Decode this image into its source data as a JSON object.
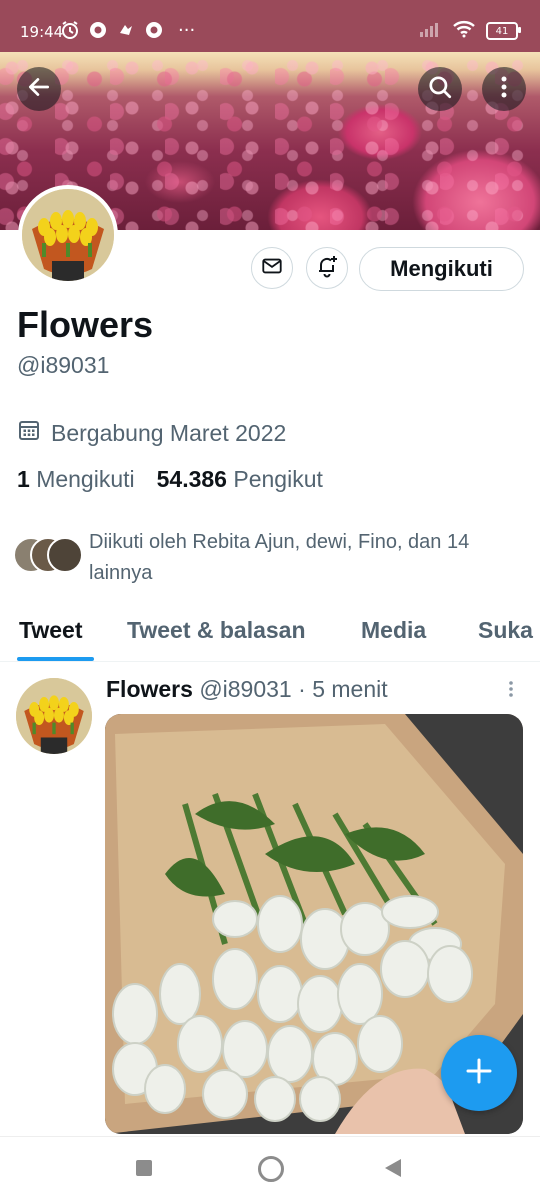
{
  "status_bar": {
    "time": "19:44",
    "battery": "41",
    "more": "···"
  },
  "profile": {
    "name": "Flowers",
    "handle": "@i89031",
    "joined": "Bergabung Maret 2022",
    "following_count": "1",
    "following_label": "Mengikuti",
    "followers_count": "54.386",
    "followers_label": "Pengikut",
    "followed_by": "Diikuti oleh Rebita Ajun, dewi, Fino, dan 14 lainnya",
    "follow_button": "Mengikuti"
  },
  "tabs": [
    "Tweet",
    "Tweet & balasan",
    "Media",
    "Suka"
  ],
  "tweet": {
    "author": "Flowers",
    "handle": "@i89031",
    "separator": "·",
    "time": "5 menit"
  },
  "colors": {
    "accent": "#1d9bf0",
    "status_bar": "#9a4a5a",
    "secondary_text": "#536471"
  },
  "icons": [
    "back-arrow-icon",
    "search-icon",
    "more-vertical-icon",
    "mail-icon",
    "bell-plus-icon",
    "calendar-icon",
    "plus-icon"
  ]
}
